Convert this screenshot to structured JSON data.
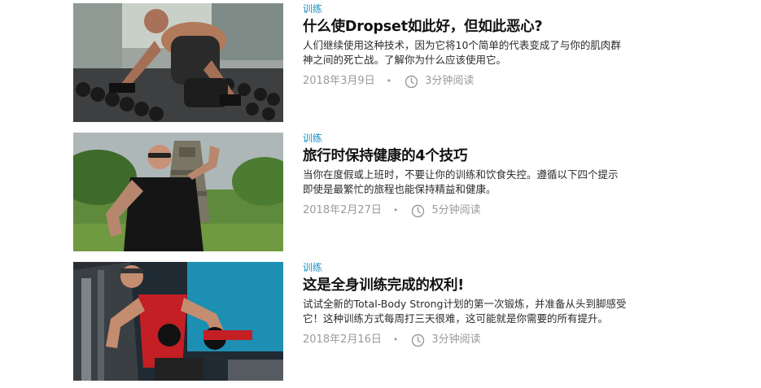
{
  "articles": [
    {
      "category": "训练",
      "title": "什么使Dropset如此好，但如此恶心?",
      "description": "人们继续使用这种技术，因为它将10个简单的代表变成了与你的肌肉群神之间的死亡战。了解你为什么应该使用它。",
      "date": "2018年3月9日",
      "separator": "•",
      "read_time": "3分钟阅读"
    },
    {
      "category": "训练",
      "title": "旅行时保持健康的4个技巧",
      "description": "当你在度假或上班时，不要让你的训练和饮食失控。遵循以下四个提示即使是最繁忙的旅程也能保持精益和健康。",
      "date": "2018年2月27日",
      "separator": "•",
      "read_time": "5分钟阅读"
    },
    {
      "category": "训练",
      "title": "这是全身训练完成的权利!",
      "description": "试试全新的Total-Body Strong计划的第一次锻炼，并准备从头到脚感受它！这种训练方式每周打三天很难，这可能就是你需要的所有提升。",
      "date": "2018年2月16日",
      "separator": "•",
      "read_time": "3分钟阅读"
    }
  ],
  "colors": {
    "category": "#1a8fc0",
    "title": "#111111",
    "meta": "#9a9a9a"
  }
}
